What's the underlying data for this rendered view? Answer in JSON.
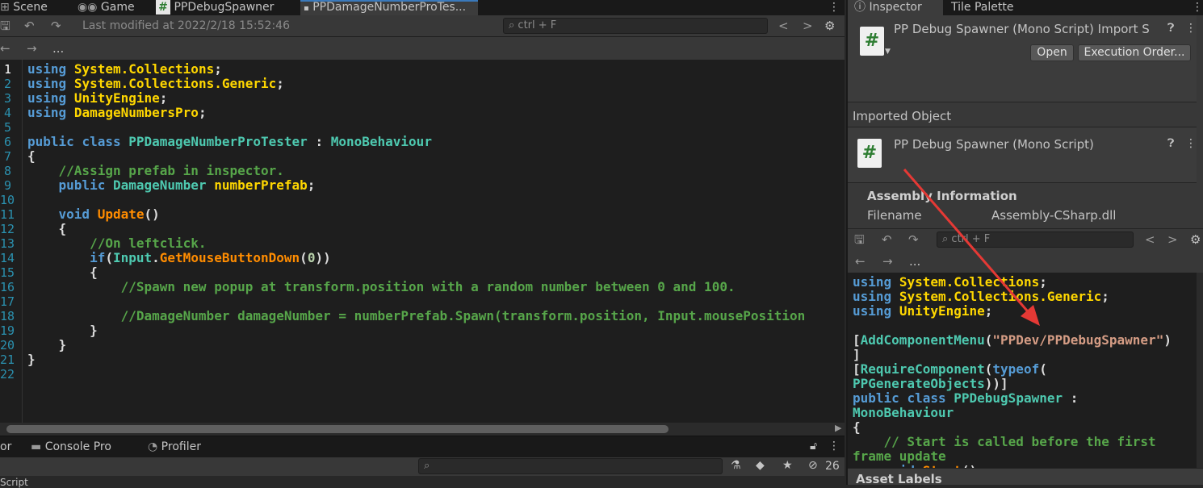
{
  "left": {
    "tabs": [
      {
        "label": "Scene",
        "icon": "grid-icon"
      },
      {
        "label": "Game",
        "icon": "gamepad-icon"
      },
      {
        "label": "PPDebugSpawner",
        "icon": "csharp-script-icon"
      },
      {
        "label": "PPDamageNumberProTes...",
        "icon": "script-icon"
      }
    ],
    "toolbar": {
      "last_modified": "Last modified at 2022/2/18 15:52:46",
      "search_placeholder": "ctrl + F",
      "prev": "<",
      "next": ">"
    },
    "nav": {
      "back": "←",
      "forward": "→",
      "more": "..."
    },
    "line_numbers": [
      "1",
      "2",
      "3",
      "4",
      "5",
      "6",
      "7",
      "8",
      "9",
      "10",
      "11",
      "12",
      "13",
      "14",
      "15",
      "16",
      "17",
      "18",
      "19",
      "20",
      "21",
      "22"
    ],
    "bottom": {
      "tabs": [
        {
          "label": "or"
        },
        {
          "label": "Console Pro",
          "icon": "console-icon"
        },
        {
          "label": "Profiler",
          "icon": "profiler-icon"
        }
      ],
      "count_badge": "26",
      "footer_text": "Script"
    }
  },
  "right": {
    "tabs": [
      {
        "label": "Inspector",
        "icon": "info-icon"
      },
      {
        "label": "Tile Palette"
      }
    ],
    "header_title": "PP Debug Spawner (Mono Script) Import S",
    "open_button": "Open",
    "exec_order_button": "Execution Order...",
    "imported_object_label": "Imported Object",
    "imported_object_title": "PP Debug Spawner (Mono Script)",
    "assembly_info_label": "Assembly Information",
    "filename_label": "Filename",
    "filename_value": "Assembly-CSharp.dll",
    "search_placeholder": "ctrl + F",
    "asset_labels": "Asset Labels"
  },
  "colors": {
    "keyword": "#569cd6",
    "type": "#4ec9b0",
    "namespace": "#ffd700",
    "method": "#ff8c00",
    "comment": "#57a64a",
    "string": "#d69d85",
    "line_number": "#2b91af",
    "annotation_arrow": "#e53935"
  }
}
